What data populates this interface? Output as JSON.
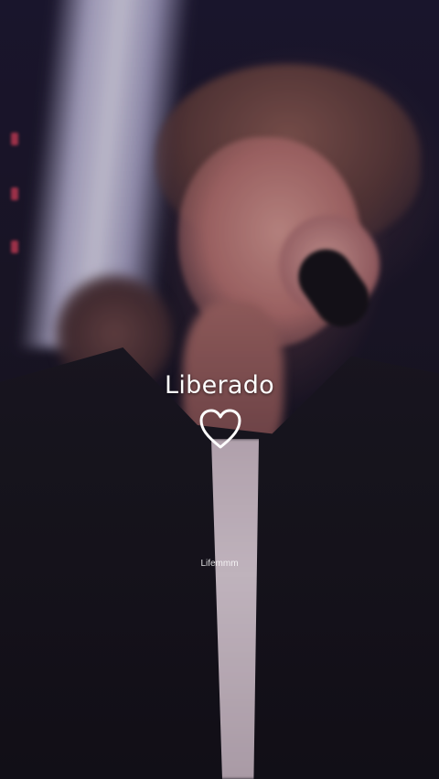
{
  "overlay": {
    "caption": "Liberado",
    "heart_icon": "heart-outline-icon",
    "watermark": "Lifemmm"
  },
  "colors": {
    "caption_text": "#ffffff",
    "background": "#141018",
    "stage_light": "#e8e6f8",
    "skin_tone": "#d79a92"
  }
}
